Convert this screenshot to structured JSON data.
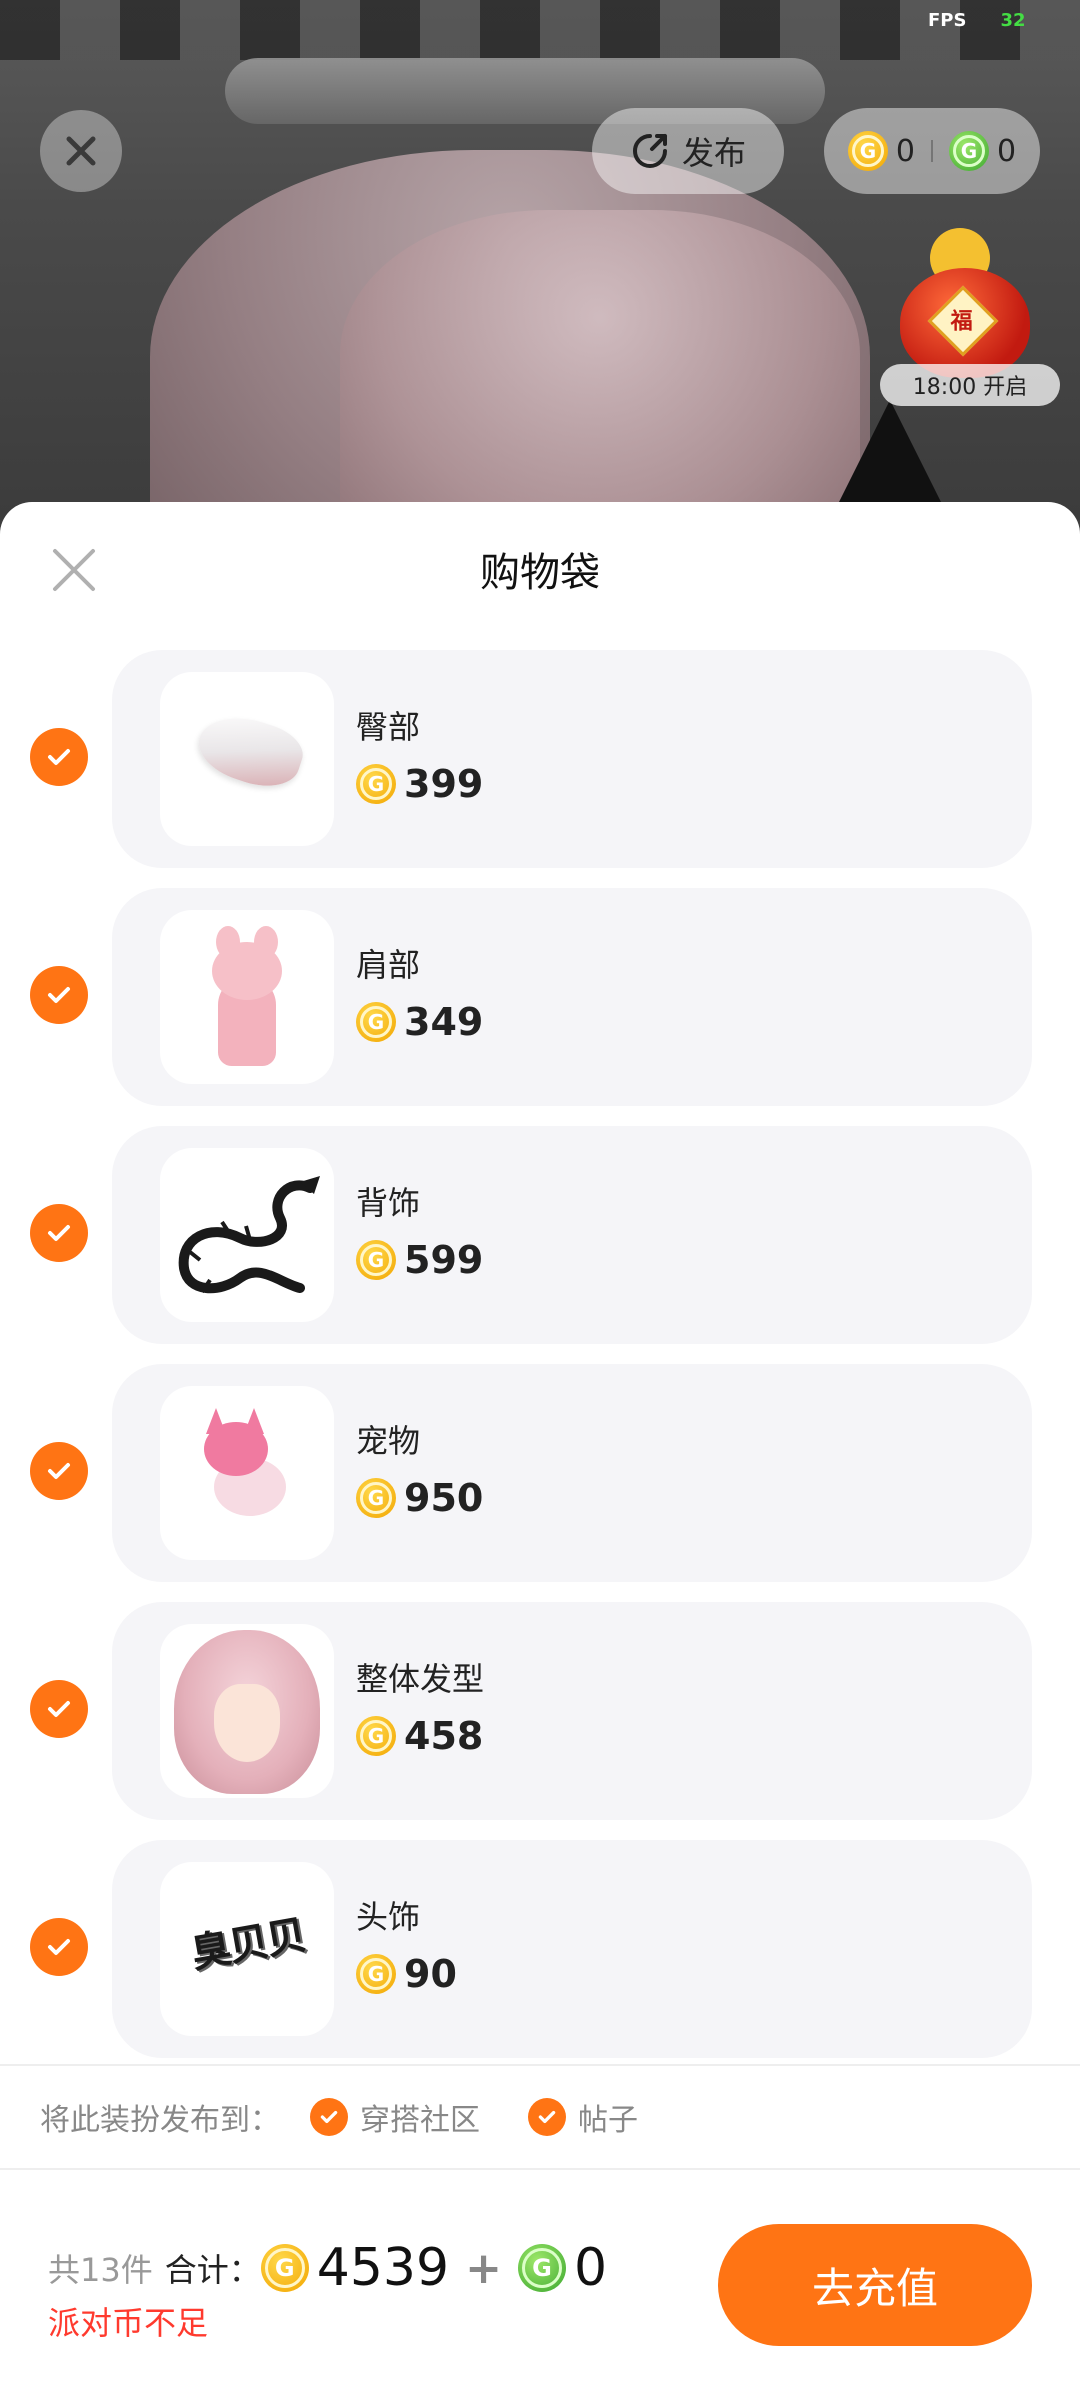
{
  "status": {
    "fps_label": "FPS",
    "fps_value": "32"
  },
  "scene": {
    "publish_label": "发布",
    "gold_balance": "0",
    "green_balance": "0",
    "event_time": "18:00 开启",
    "event_glyph": "福"
  },
  "panel": {
    "title": "购物袋",
    "items": [
      {
        "name": "臀部",
        "price": "399",
        "thumb_icon": "white-wing-tail-icon",
        "selected": true
      },
      {
        "name": "肩部",
        "price": "349",
        "thumb_icon": "pink-bunny-icon",
        "selected": true
      },
      {
        "name": "背饰",
        "price": "599",
        "thumb_icon": "black-dragon-icon",
        "selected": true
      },
      {
        "name": "宠物",
        "price": "950",
        "thumb_icon": "pink-fox-pet-icon",
        "selected": true
      },
      {
        "name": "整体发型",
        "price": "458",
        "thumb_icon": "pink-hair-icon",
        "selected": true
      },
      {
        "name": "头饰",
        "price": "90",
        "thumb_icon": "text-headwear-icon",
        "thumb_text": "臭贝贝",
        "selected": true
      }
    ],
    "publish": {
      "label": "将此装扮发布到：",
      "options": [
        "穿搭社区",
        "帖子"
      ]
    },
    "footer": {
      "count_label": "共13件",
      "total_label": "合计：",
      "gold_total": "4539",
      "plus": "+",
      "green_total": "0",
      "warning": "派对币不足",
      "recharge_label": "去充值"
    }
  },
  "colors": {
    "accent": "#ff7414",
    "warning": "#ff3a2e",
    "gold_coin": "#f2a500",
    "green_coin": "#3aa62e",
    "card_bg": "#f5f5f8"
  }
}
